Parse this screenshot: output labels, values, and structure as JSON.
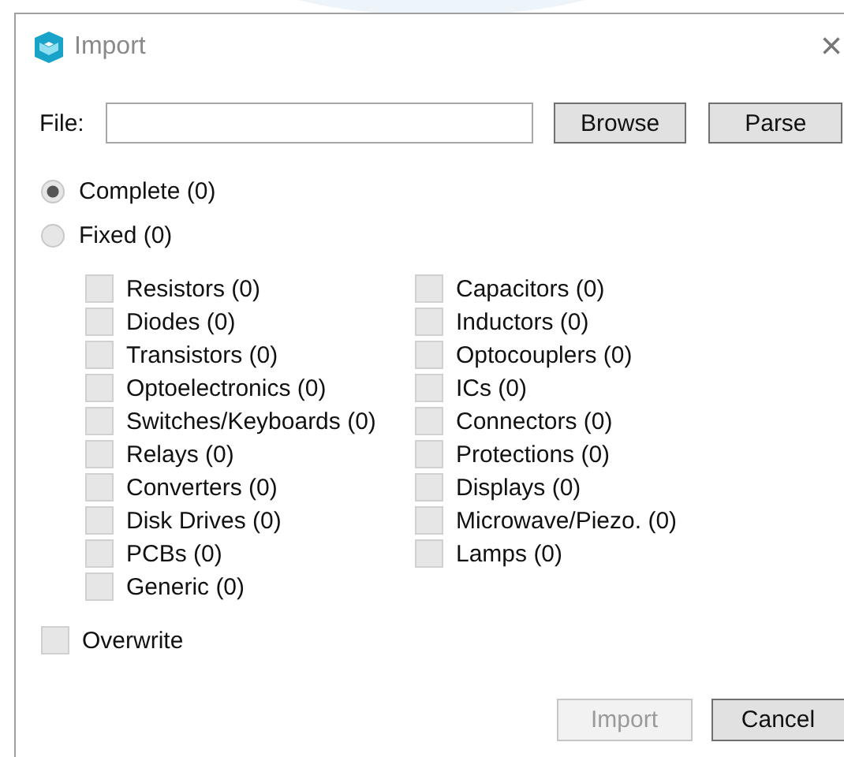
{
  "window": {
    "title": "Import",
    "close": "×"
  },
  "file": {
    "label": "File:"
  },
  "file_buttons": [
    {
      "label": "Browse",
      "disabled": false
    },
    {
      "label": "Parse",
      "disabled": false
    }
  ],
  "modes": [
    {
      "label": "Complete (0)",
      "selected": true
    },
    {
      "label": "Fixed (0)",
      "selected": false
    }
  ],
  "categories": [
    [
      {
        "label": "Resistors (0)",
        "checked": false
      },
      {
        "label": "Diodes (0)",
        "checked": false
      },
      {
        "label": "Transistors (0)",
        "checked": false
      },
      {
        "label": "Optoelectronics (0)",
        "checked": false
      },
      {
        "label": "Switches/Keyboards (0)",
        "checked": false
      },
      {
        "label": "Relays (0)",
        "checked": false
      },
      {
        "label": "Converters (0)",
        "checked": false
      },
      {
        "label": "Disk Drives (0)",
        "checked": false
      },
      {
        "label": "PCBs (0)",
        "checked": false
      },
      {
        "label": "Generic (0)",
        "checked": false
      }
    ],
    [
      {
        "label": "Capacitors (0)",
        "checked": false
      },
      {
        "label": "Inductors (0)",
        "checked": false
      },
      {
        "label": "Optocouplers (0)",
        "checked": false
      },
      {
        "label": "ICs (0)",
        "checked": false
      },
      {
        "label": "Connectors (0)",
        "checked": false
      },
      {
        "label": "Protections (0)",
        "checked": false
      },
      {
        "label": "Displays (0)",
        "checked": false
      },
      {
        "label": "Microwave/Piezo. (0)",
        "checked": false
      },
      {
        "label": "Lamps (0)",
        "checked": false
      }
    ]
  ],
  "overwrite": {
    "label": "Overwrite",
    "checked": false
  },
  "buttons": [
    {
      "label": "Import",
      "disabled": true
    },
    {
      "label": "Cancel",
      "disabled": false
    }
  ]
}
